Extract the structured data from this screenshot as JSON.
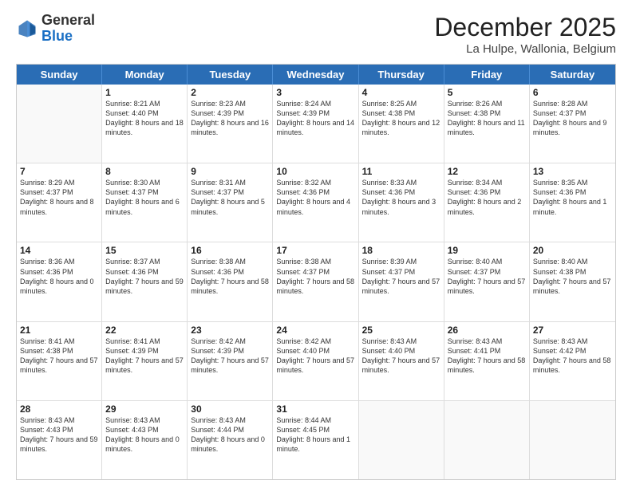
{
  "header": {
    "logo_general": "General",
    "logo_blue": "Blue",
    "title": "December 2025",
    "subtitle": "La Hulpe, Wallonia, Belgium"
  },
  "days_of_week": [
    "Sunday",
    "Monday",
    "Tuesday",
    "Wednesday",
    "Thursday",
    "Friday",
    "Saturday"
  ],
  "weeks": [
    [
      {
        "day": "",
        "empty": true
      },
      {
        "day": "1",
        "sunrise": "8:21 AM",
        "sunset": "4:40 PM",
        "daylight": "8 hours and 18 minutes."
      },
      {
        "day": "2",
        "sunrise": "8:23 AM",
        "sunset": "4:39 PM",
        "daylight": "8 hours and 16 minutes."
      },
      {
        "day": "3",
        "sunrise": "8:24 AM",
        "sunset": "4:39 PM",
        "daylight": "8 hours and 14 minutes."
      },
      {
        "day": "4",
        "sunrise": "8:25 AM",
        "sunset": "4:38 PM",
        "daylight": "8 hours and 12 minutes."
      },
      {
        "day": "5",
        "sunrise": "8:26 AM",
        "sunset": "4:38 PM",
        "daylight": "8 hours and 11 minutes."
      },
      {
        "day": "6",
        "sunrise": "8:28 AM",
        "sunset": "4:37 PM",
        "daylight": "8 hours and 9 minutes."
      }
    ],
    [
      {
        "day": "7",
        "sunrise": "8:29 AM",
        "sunset": "4:37 PM",
        "daylight": "8 hours and 8 minutes."
      },
      {
        "day": "8",
        "sunrise": "8:30 AM",
        "sunset": "4:37 PM",
        "daylight": "8 hours and 6 minutes."
      },
      {
        "day": "9",
        "sunrise": "8:31 AM",
        "sunset": "4:37 PM",
        "daylight": "8 hours and 5 minutes."
      },
      {
        "day": "10",
        "sunrise": "8:32 AM",
        "sunset": "4:36 PM",
        "daylight": "8 hours and 4 minutes."
      },
      {
        "day": "11",
        "sunrise": "8:33 AM",
        "sunset": "4:36 PM",
        "daylight": "8 hours and 3 minutes."
      },
      {
        "day": "12",
        "sunrise": "8:34 AM",
        "sunset": "4:36 PM",
        "daylight": "8 hours and 2 minutes."
      },
      {
        "day": "13",
        "sunrise": "8:35 AM",
        "sunset": "4:36 PM",
        "daylight": "8 hours and 1 minute."
      }
    ],
    [
      {
        "day": "14",
        "sunrise": "8:36 AM",
        "sunset": "4:36 PM",
        "daylight": "8 hours and 0 minutes."
      },
      {
        "day": "15",
        "sunrise": "8:37 AM",
        "sunset": "4:36 PM",
        "daylight": "7 hours and 59 minutes."
      },
      {
        "day": "16",
        "sunrise": "8:38 AM",
        "sunset": "4:36 PM",
        "daylight": "7 hours and 58 minutes."
      },
      {
        "day": "17",
        "sunrise": "8:38 AM",
        "sunset": "4:37 PM",
        "daylight": "7 hours and 58 minutes."
      },
      {
        "day": "18",
        "sunrise": "8:39 AM",
        "sunset": "4:37 PM",
        "daylight": "7 hours and 57 minutes."
      },
      {
        "day": "19",
        "sunrise": "8:40 AM",
        "sunset": "4:37 PM",
        "daylight": "7 hours and 57 minutes."
      },
      {
        "day": "20",
        "sunrise": "8:40 AM",
        "sunset": "4:38 PM",
        "daylight": "7 hours and 57 minutes."
      }
    ],
    [
      {
        "day": "21",
        "sunrise": "8:41 AM",
        "sunset": "4:38 PM",
        "daylight": "7 hours and 57 minutes."
      },
      {
        "day": "22",
        "sunrise": "8:41 AM",
        "sunset": "4:39 PM",
        "daylight": "7 hours and 57 minutes."
      },
      {
        "day": "23",
        "sunrise": "8:42 AM",
        "sunset": "4:39 PM",
        "daylight": "7 hours and 57 minutes."
      },
      {
        "day": "24",
        "sunrise": "8:42 AM",
        "sunset": "4:40 PM",
        "daylight": "7 hours and 57 minutes."
      },
      {
        "day": "25",
        "sunrise": "8:43 AM",
        "sunset": "4:40 PM",
        "daylight": "7 hours and 57 minutes."
      },
      {
        "day": "26",
        "sunrise": "8:43 AM",
        "sunset": "4:41 PM",
        "daylight": "7 hours and 58 minutes."
      },
      {
        "day": "27",
        "sunrise": "8:43 AM",
        "sunset": "4:42 PM",
        "daylight": "7 hours and 58 minutes."
      }
    ],
    [
      {
        "day": "28",
        "sunrise": "8:43 AM",
        "sunset": "4:43 PM",
        "daylight": "7 hours and 59 minutes."
      },
      {
        "day": "29",
        "sunrise": "8:43 AM",
        "sunset": "4:43 PM",
        "daylight": "8 hours and 0 minutes."
      },
      {
        "day": "30",
        "sunrise": "8:43 AM",
        "sunset": "4:44 PM",
        "daylight": "8 hours and 0 minutes."
      },
      {
        "day": "31",
        "sunrise": "8:44 AM",
        "sunset": "4:45 PM",
        "daylight": "8 hours and 1 minute."
      },
      {
        "day": "",
        "empty": true
      },
      {
        "day": "",
        "empty": true
      },
      {
        "day": "",
        "empty": true
      }
    ]
  ]
}
